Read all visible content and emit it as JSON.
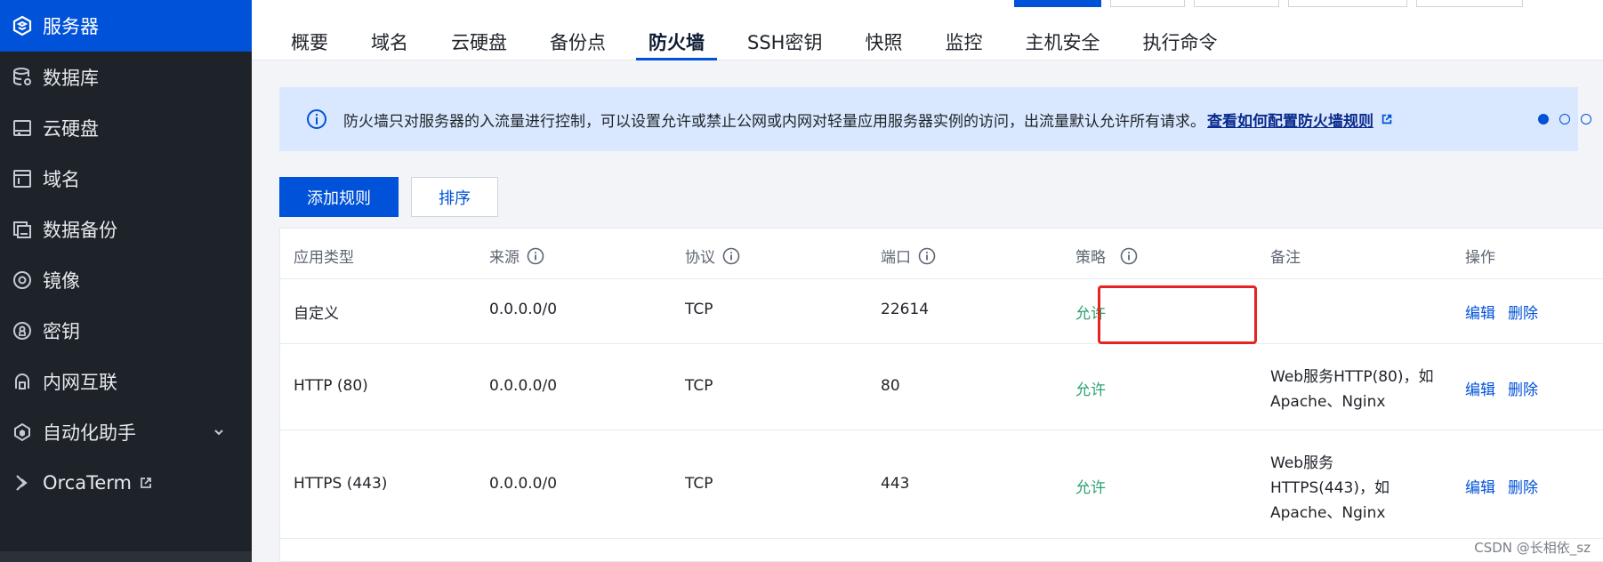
{
  "sidebar": {
    "items": [
      {
        "label": "服务器",
        "icon": "server-icon",
        "active": true
      },
      {
        "label": "数据库",
        "icon": "database-icon"
      },
      {
        "label": "云硬盘",
        "icon": "disk-icon"
      },
      {
        "label": "域名",
        "icon": "domain-icon"
      },
      {
        "label": "数据备份",
        "icon": "backup-icon"
      },
      {
        "label": "镜像",
        "icon": "image-icon"
      },
      {
        "label": "密钥",
        "icon": "key-icon"
      },
      {
        "label": "内网互联",
        "icon": "network-icon"
      },
      {
        "label": "自动化助手",
        "icon": "automation-icon",
        "has_chevron": true
      },
      {
        "label": "OrcaTerm",
        "icon": "orcaterm-icon",
        "external": true
      }
    ]
  },
  "tabs": [
    "概要",
    "域名",
    "云硬盘",
    "备份点",
    "防火墙",
    "SSH密钥",
    "快照",
    "监控",
    "主机安全",
    "执行命令"
  ],
  "active_tab": "防火墙",
  "notice": {
    "text": "防火墙只对服务器的入流量进行控制，可以设置允许或禁止公网或内网对轻量应用服务器实例的访问，出流量默认允许所有请求。",
    "link": "查看如何配置防火墙规则",
    "close": "×"
  },
  "actions": {
    "add_rule": "添加规则",
    "sort": "排序"
  },
  "table": {
    "headers": {
      "type": "应用类型",
      "source": "来源",
      "protocol": "协议",
      "port": "端口",
      "policy": "策略",
      "note": "备注",
      "ops": "操作"
    },
    "rows": [
      {
        "type": "自定义",
        "source": "0.0.0.0/0",
        "protocol": "TCP",
        "port": "22614",
        "policy": "允许",
        "note_line1": "",
        "note_line2": "",
        "note_line3": "",
        "edit": "编辑",
        "delete": "删除"
      },
      {
        "type": "HTTP (80)",
        "source": "0.0.0.0/0",
        "protocol": "TCP",
        "port": "80",
        "policy": "允许",
        "note_line1": "Web服务HTTP(80)，如",
        "note_line2": "Apache、Nginx",
        "note_line3": "",
        "edit": "编辑",
        "delete": "删除"
      },
      {
        "type": "HTTPS (443)",
        "source": "0.0.0.0/0",
        "protocol": "TCP",
        "port": "443",
        "policy": "允许",
        "note_line1": "Web服务",
        "note_line2": "HTTPS(443)，如",
        "note_line3": "Apache、Nginx",
        "edit": "编辑",
        "delete": "删除"
      }
    ]
  },
  "watermark": "CSDN @长相依_sz",
  "colors": {
    "sidebar_bg": "#1e2329",
    "accent": "#0052d9",
    "allow": "#2ba471",
    "highlight": "#e52323",
    "notice_bg": "#d9e8ff"
  }
}
